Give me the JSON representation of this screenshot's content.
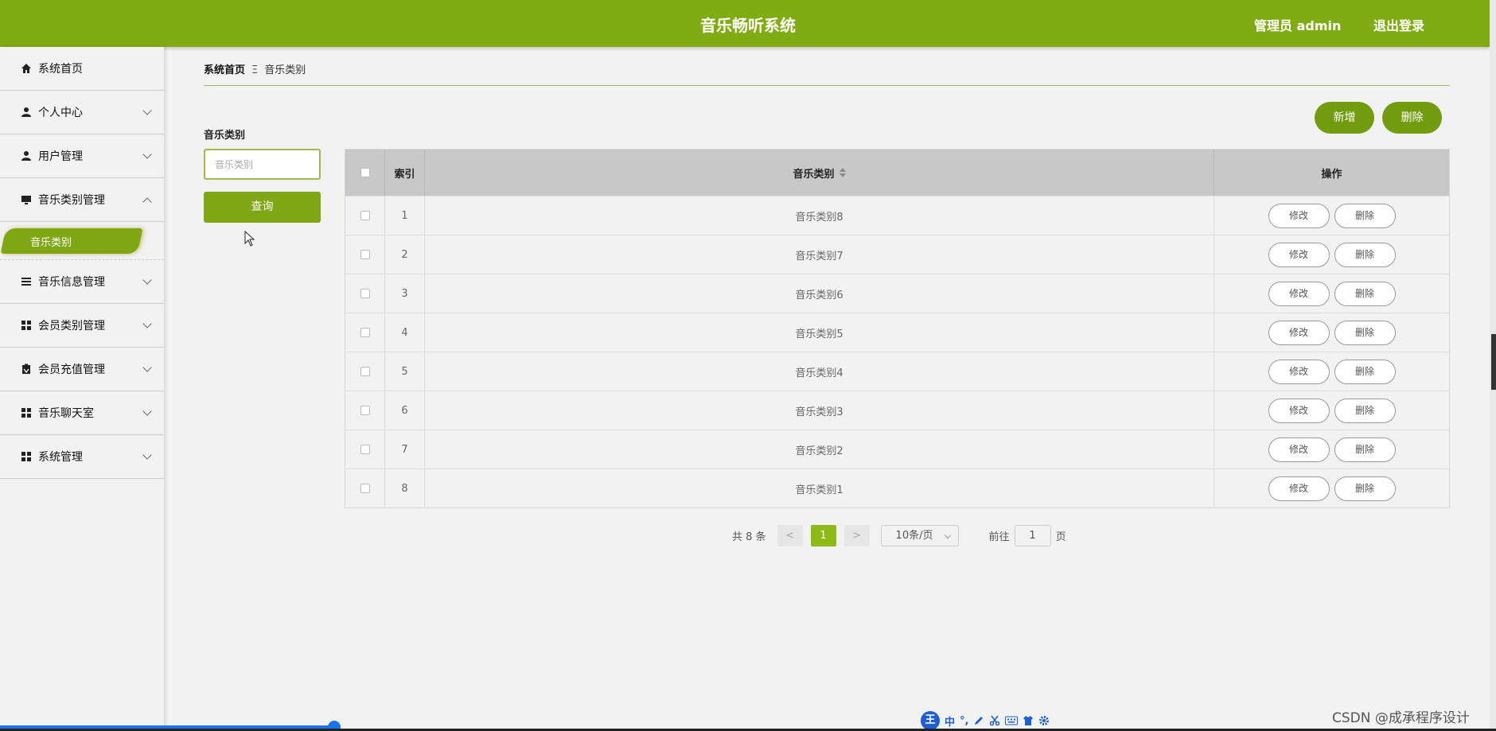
{
  "header": {
    "title": "音乐畅听系统",
    "user": "管理员 admin",
    "logout": "退出登录"
  },
  "sidebar": {
    "items": [
      {
        "label": "系统首页",
        "icon": "home-icon"
      },
      {
        "label": "个人中心",
        "icon": "user-icon"
      },
      {
        "label": "用户管理",
        "icon": "user-icon"
      },
      {
        "label": "音乐类别管理",
        "icon": "monitor-icon",
        "expanded": true
      },
      {
        "label": "音乐信息管理",
        "icon": "list-icon"
      },
      {
        "label": "会员类别管理",
        "icon": "grid-icon"
      },
      {
        "label": "会员充值管理",
        "icon": "clipboard-icon"
      },
      {
        "label": "音乐聊天室",
        "icon": "grid-icon"
      },
      {
        "label": "系统管理",
        "icon": "grid-icon"
      }
    ],
    "sub_item": "音乐类别"
  },
  "breadcrumb": {
    "home": "系统首页",
    "sep": "Ξ",
    "current": "音乐类别"
  },
  "filter": {
    "label": "音乐类别",
    "placeholder": "音乐类别",
    "query": "查询"
  },
  "actions": {
    "add": "新增",
    "delete": "删除"
  },
  "table": {
    "headers": {
      "index": "索引",
      "name": "音乐类别",
      "ops": "操作"
    },
    "edit_label": "修改",
    "delete_label": "删除",
    "rows": [
      {
        "index": "1",
        "name": "音乐类别8"
      },
      {
        "index": "2",
        "name": "音乐类别7"
      },
      {
        "index": "3",
        "name": "音乐类别6"
      },
      {
        "index": "4",
        "name": "音乐类别5"
      },
      {
        "index": "5",
        "name": "音乐类别4"
      },
      {
        "index": "6",
        "name": "音乐类别3"
      },
      {
        "index": "7",
        "name": "音乐类别2"
      },
      {
        "index": "8",
        "name": "音乐类别1"
      }
    ]
  },
  "pagination": {
    "total": "共 8 条",
    "prev": "<",
    "page": "1",
    "next": ">",
    "size": "10条/页",
    "goto_prefix": "前往",
    "goto_value": "1",
    "goto_suffix": "页"
  },
  "ime": {
    "logo": "王",
    "mode": "中"
  },
  "watermark": "CSDN @成承程序设计",
  "colors": {
    "brand": "#81ab13",
    "accent": "#7ea713"
  }
}
